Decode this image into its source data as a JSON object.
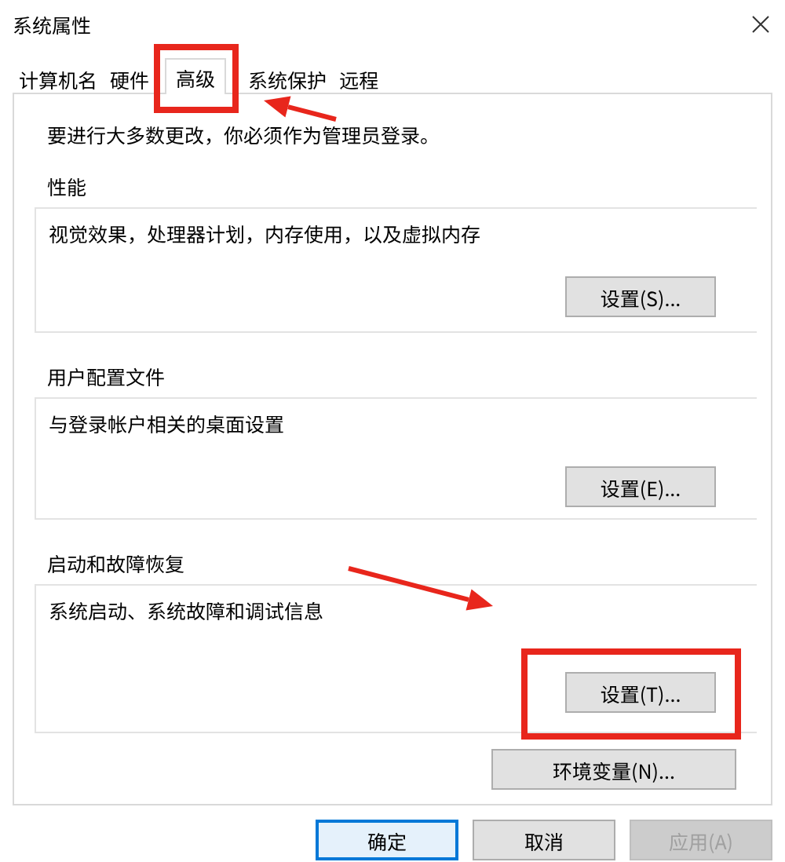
{
  "window": {
    "title": "系统属性"
  },
  "tabs": [
    {
      "label": "计算机名",
      "selected": false,
      "highlighted": false
    },
    {
      "label": "硬件",
      "selected": false,
      "highlighted": false
    },
    {
      "label": "高级",
      "selected": true,
      "highlighted": true
    },
    {
      "label": "系统保护",
      "selected": false,
      "highlighted": false
    },
    {
      "label": "远程",
      "selected": false,
      "highlighted": false
    }
  ],
  "notice": "要进行大多数更改，你必须作为管理员登录。",
  "groups": [
    {
      "title": "性能",
      "description": "视觉效果，处理器计划，内存使用，以及虚拟内存",
      "button": "设置(S)...",
      "highlighted": false
    },
    {
      "title": "用户配置文件",
      "description": "与登录帐户相关的桌面设置",
      "button": "设置(E)...",
      "highlighted": false
    },
    {
      "title": "启动和故障恢复",
      "description": "系统启动、系统故障和调试信息",
      "button": "设置(T)...",
      "highlighted": true
    }
  ],
  "env_button": "环境变量(N)...",
  "buttons": [
    {
      "label": "确定",
      "kind": "default",
      "disabled": false
    },
    {
      "label": "取消",
      "kind": "normal",
      "disabled": false
    },
    {
      "label": "应用(A)",
      "kind": "normal",
      "disabled": true
    }
  ]
}
